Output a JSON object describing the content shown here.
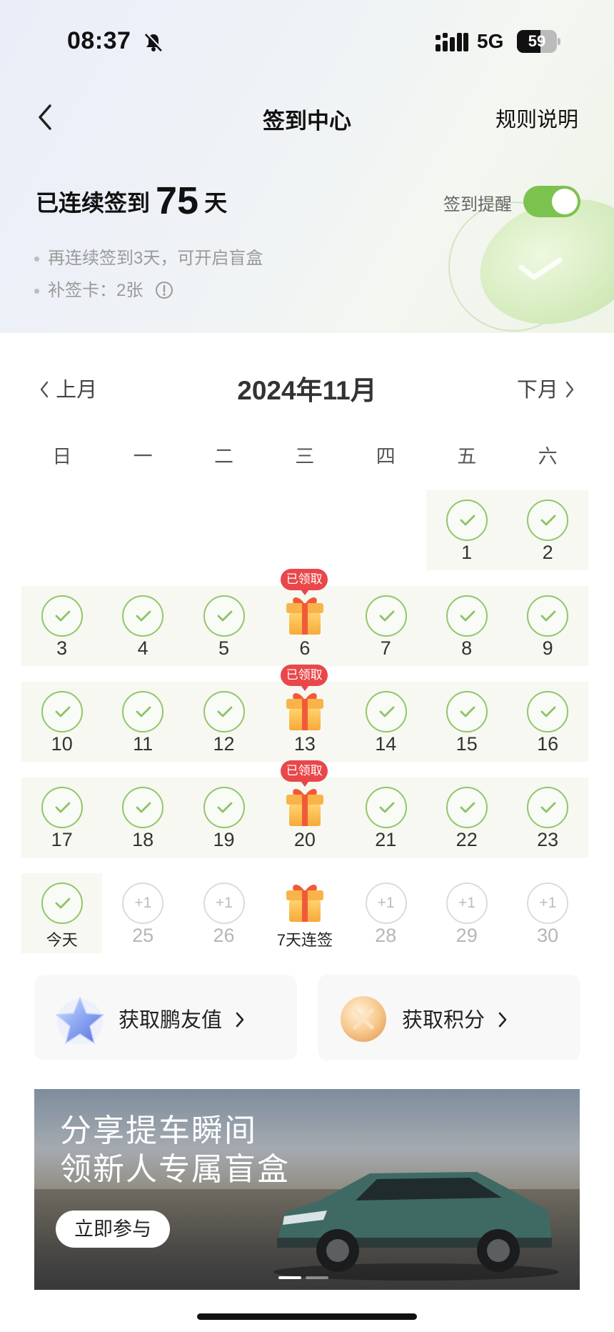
{
  "status_bar": {
    "time": "08:37",
    "network": "5G",
    "battery": "59",
    "battery_level": 0.59
  },
  "nav": {
    "title": "签到中心",
    "rules": "规则说明"
  },
  "summary": {
    "prefix": "已连续签到",
    "days": "75",
    "suffix": "天",
    "tip1": "再连续签到3天，可开启盲盒",
    "tip2": "补签卡：2张",
    "reminder_label": "签到提醒",
    "reminder_on": true
  },
  "calendar": {
    "prev": "上月",
    "next": "下月",
    "title": "2024年11月",
    "weekdays": [
      "日",
      "一",
      "二",
      "三",
      "四",
      "五",
      "六"
    ],
    "claimed_label": "已领取",
    "weeks": [
      [
        null,
        null,
        null,
        null,
        null,
        {
          "label": "1",
          "state": "checked"
        },
        {
          "label": "2",
          "state": "checked"
        }
      ],
      [
        {
          "label": "3",
          "state": "checked"
        },
        {
          "label": "4",
          "state": "checked"
        },
        {
          "label": "5",
          "state": "checked"
        },
        {
          "label": "6",
          "state": "gift-claimed"
        },
        {
          "label": "7",
          "state": "checked"
        },
        {
          "label": "8",
          "state": "checked"
        },
        {
          "label": "9",
          "state": "checked"
        }
      ],
      [
        {
          "label": "10",
          "state": "checked"
        },
        {
          "label": "11",
          "state": "checked"
        },
        {
          "label": "12",
          "state": "checked"
        },
        {
          "label": "13",
          "state": "gift-claimed"
        },
        {
          "label": "14",
          "state": "checked"
        },
        {
          "label": "15",
          "state": "checked"
        },
        {
          "label": "16",
          "state": "checked"
        }
      ],
      [
        {
          "label": "17",
          "state": "checked"
        },
        {
          "label": "18",
          "state": "checked"
        },
        {
          "label": "19",
          "state": "checked"
        },
        {
          "label": "20",
          "state": "gift-claimed"
        },
        {
          "label": "21",
          "state": "checked"
        },
        {
          "label": "22",
          "state": "checked"
        },
        {
          "label": "23",
          "state": "checked"
        }
      ],
      [
        {
          "label": "今天",
          "state": "today"
        },
        {
          "label": "25",
          "state": "future",
          "bonus": "+1"
        },
        {
          "label": "26",
          "state": "future",
          "bonus": "+1"
        },
        {
          "label": "7天连签",
          "state": "gift"
        },
        {
          "label": "28",
          "state": "future",
          "bonus": "+1"
        },
        {
          "label": "29",
          "state": "future",
          "bonus": "+1"
        },
        {
          "label": "30",
          "state": "future",
          "bonus": "+1"
        }
      ]
    ]
  },
  "cards": {
    "friend": "获取鹏友值",
    "points": "获取积分"
  },
  "banner": {
    "line1": "分享提车瞬间",
    "line2": "领新人专属盲盒",
    "cta": "立即参与"
  },
  "colors": {
    "accent_green": "#7cc24f",
    "check_green": "#93c56c",
    "badge_red": "#e9474a"
  }
}
